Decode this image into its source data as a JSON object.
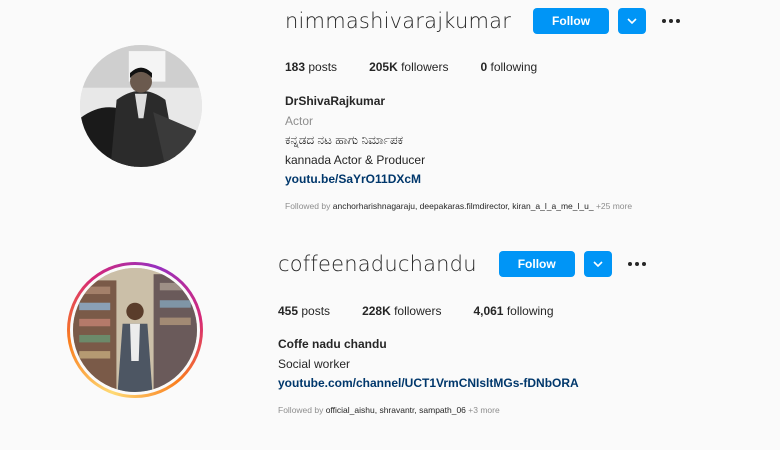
{
  "profiles": [
    {
      "username": "nimmashivarajkumar",
      "follow_label": "Follow",
      "posts": "183",
      "posts_label": "posts",
      "followers": "205K",
      "followers_label": "followers",
      "following": "0",
      "following_label": "following",
      "full_name": "DrShivaRajkumar",
      "category": "Actor",
      "bio_line1": "ಕನ್ನಡದ ನಟ ಹಾಗು ನಿರ್ಮಾಪಕ",
      "bio_line2": "kannada Actor & Producer",
      "link": "youtu.be/SaYrO11DXcM",
      "followed_by_prefix": "Followed by",
      "followed_by_names": "anchorharishnagaraju, deepakaras.filmdirector, kiran_a_l_a_me_l_u_",
      "followed_by_more": "+25 more",
      "avatar_ring": false
    },
    {
      "username": "coffeenaduchandu",
      "follow_label": "Follow",
      "posts": "455",
      "posts_label": "posts",
      "followers": "228K",
      "followers_label": "followers",
      "following": "4,061",
      "following_label": "following",
      "full_name": "Coffe nadu chandu",
      "category": "Social worker",
      "link": "youtube.com/channel/UCT1VrmCNIsltMGs-fDNbORA",
      "followed_by_prefix": "Followed by",
      "followed_by_names": "official_aishu, shravantr, sampath_06",
      "followed_by_more": "+3 more",
      "avatar_ring": true
    }
  ],
  "colors": {
    "accent": "#0095f6",
    "text": "#262626",
    "muted": "#8e8e8e",
    "link": "#00376b",
    "background": "#fafafa"
  },
  "icons": {
    "dropdown": "chevron-down-icon",
    "more": "more-options-icon"
  }
}
